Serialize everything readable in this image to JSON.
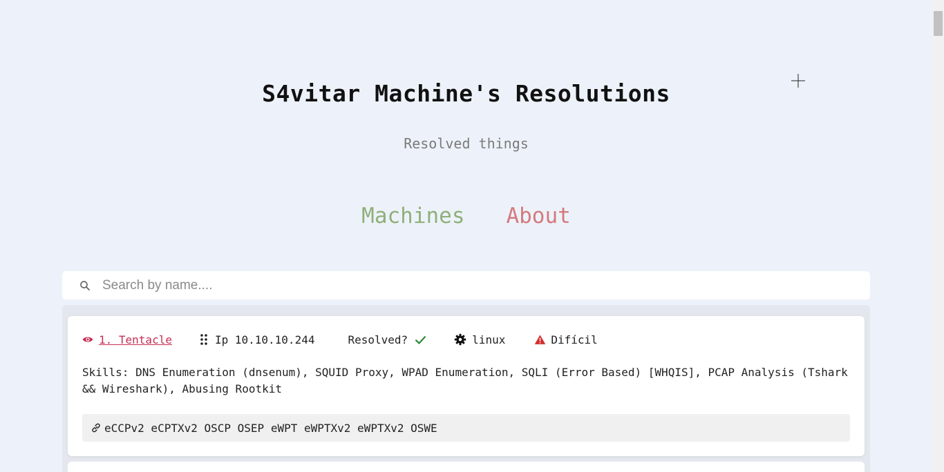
{
  "header": {
    "title": "S4vitar Machine's Resolutions",
    "subtitle": "Resolved things"
  },
  "nav": {
    "machines_label": "Machines",
    "about_label": "About"
  },
  "search": {
    "placeholder": "Search by name....",
    "value": ""
  },
  "machines": [
    {
      "name": "1. Tentacle",
      "ip": "Ip 10.10.10.244",
      "resolved_label": "Resolved?",
      "os": "linux",
      "difficulty": "Difícil",
      "skills": "Skills: DNS Enumeration (dnsenum), SQUID Proxy, WPAD Enumeration, SQLI (Error Based) [WHQIS], PCAP Analysis (Tshark && Wireshark), Abusing Rootkit",
      "certifications": "eCCPv2 eCPTXv2 OSCP OSEP eWPT eWPTXv2 eWPTXv2 OSWE"
    }
  ],
  "colors": {
    "background": "#edf2fa",
    "machines_link": "#8fb07a",
    "about_link": "#d47a7d",
    "machine_name": "#c62d52",
    "resolved_check": "#2e8b3a",
    "difficulty_warning": "#d32f2f"
  },
  "icons": {
    "name": "eye-icon",
    "ip": "grip-dots-icon",
    "resolved": "check-icon",
    "os": "gear-icon",
    "difficulty": "warning-icon",
    "certs": "link-icon",
    "search": "search-icon"
  }
}
